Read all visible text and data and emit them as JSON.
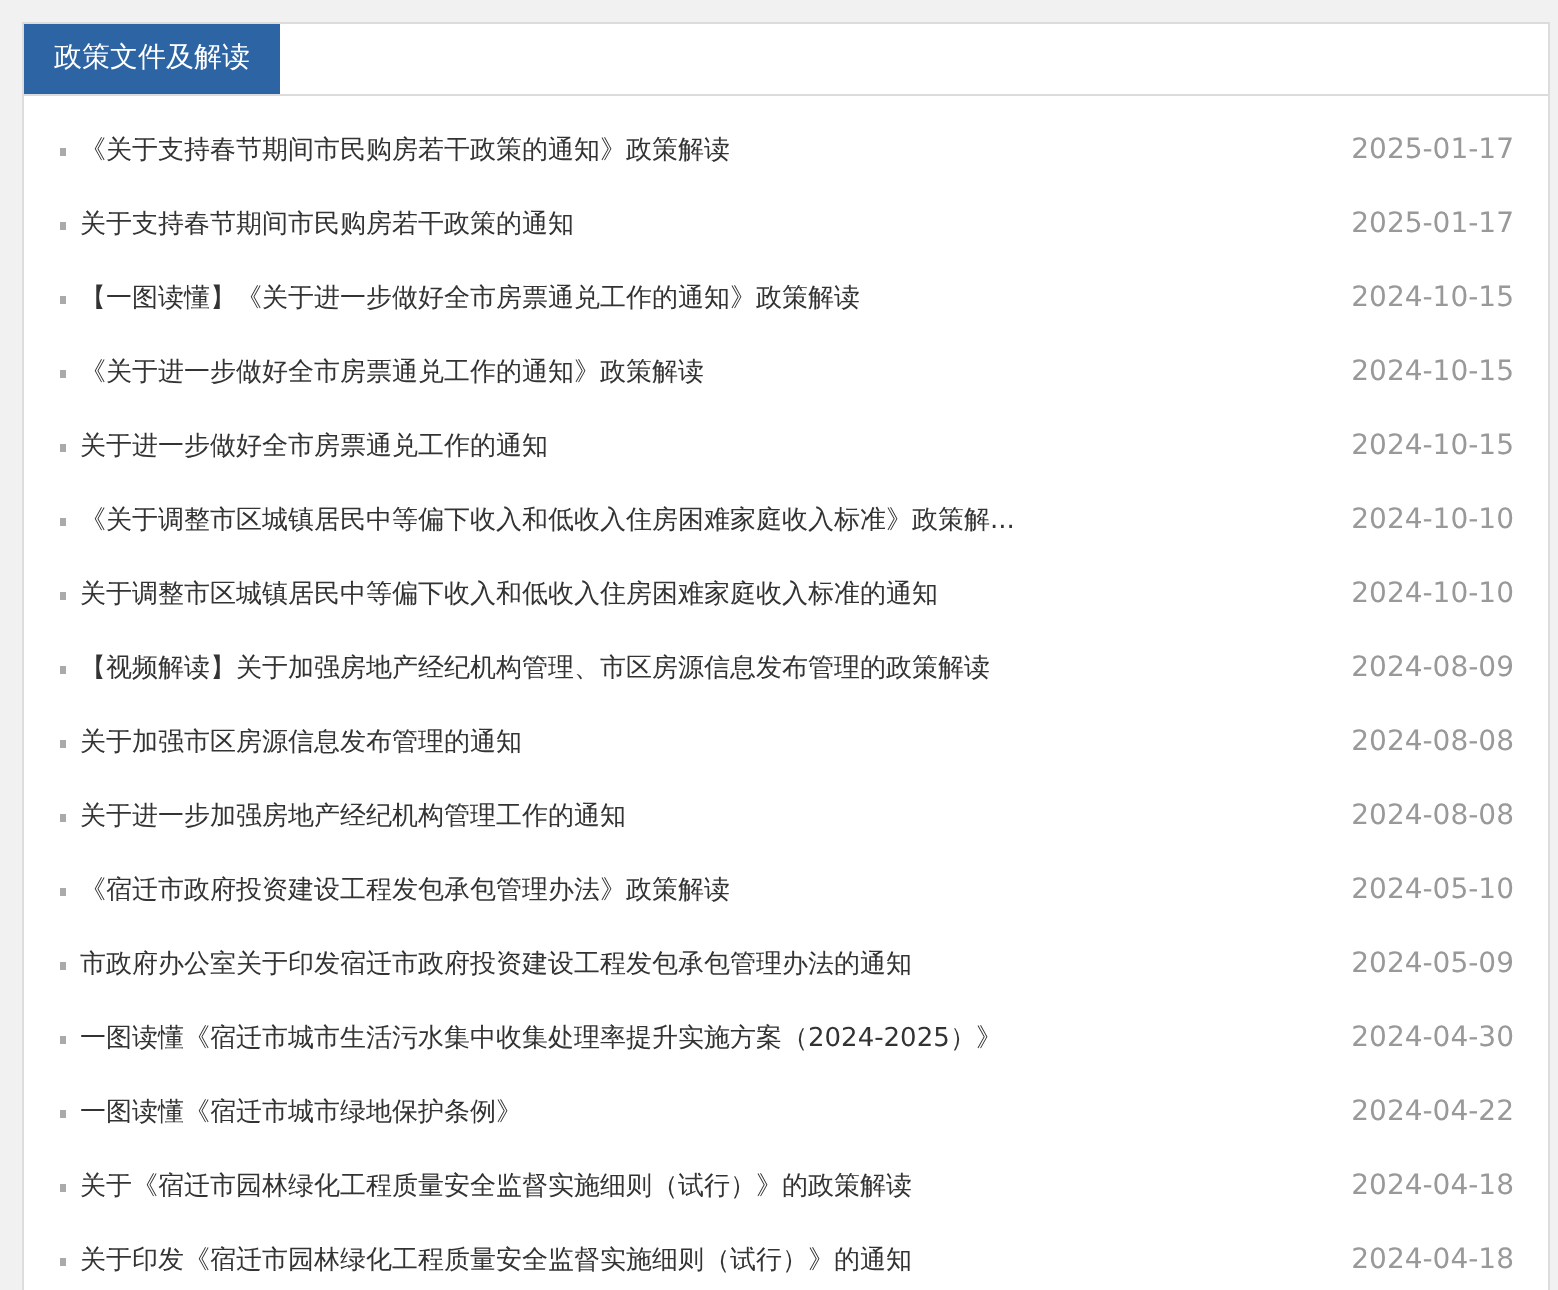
{
  "panel": {
    "title": "政策文件及解读"
  },
  "items": [
    {
      "title": "《关于支持春节期间市民购房若干政策的通知》政策解读",
      "date": "2025-01-17"
    },
    {
      "title": "关于支持春节期间市民购房若干政策的通知",
      "date": "2025-01-17"
    },
    {
      "title": "【一图读懂】《关于进一步做好全市房票通兑工作的通知》政策解读",
      "date": "2024-10-15"
    },
    {
      "title": "《关于进一步做好全市房票通兑工作的通知》政策解读",
      "date": "2024-10-15"
    },
    {
      "title": "关于进一步做好全市房票通兑工作的通知",
      "date": "2024-10-15"
    },
    {
      "title": "《关于调整市区城镇居民中等偏下收入和低收入住房困难家庭收入标准》政策解...",
      "date": "2024-10-10"
    },
    {
      "title": "关于调整市区城镇居民中等偏下收入和低收入住房困难家庭收入标准的通知",
      "date": "2024-10-10"
    },
    {
      "title": "【视频解读】关于加强房地产经纪机构管理、市区房源信息发布管理的政策解读",
      "date": "2024-08-09"
    },
    {
      "title": "关于加强市区房源信息发布管理的通知",
      "date": "2024-08-08"
    },
    {
      "title": "关于进一步加强房地产经纪机构管理工作的通知",
      "date": "2024-08-08"
    },
    {
      "title": "《宿迁市政府投资建设工程发包承包管理办法》政策解读",
      "date": "2024-05-10"
    },
    {
      "title": "市政府办公室关于印发宿迁市政府投资建设工程发包承包管理办法的通知",
      "date": "2024-05-09"
    },
    {
      "title": "一图读懂《宿迁市城市生活污水集中收集处理率提升实施方案（2024-2025）》",
      "date": "2024-04-30"
    },
    {
      "title": "一图读懂《宿迁市城市绿地保护条例》",
      "date": "2024-04-22"
    },
    {
      "title": "关于《宿迁市园林绿化工程质量安全监督实施细则（试行）》的政策解读",
      "date": "2024-04-18"
    },
    {
      "title": "关于印发《宿迁市园林绿化工程质量安全监督实施细则（试行）》的通知",
      "date": "2024-04-18"
    }
  ]
}
